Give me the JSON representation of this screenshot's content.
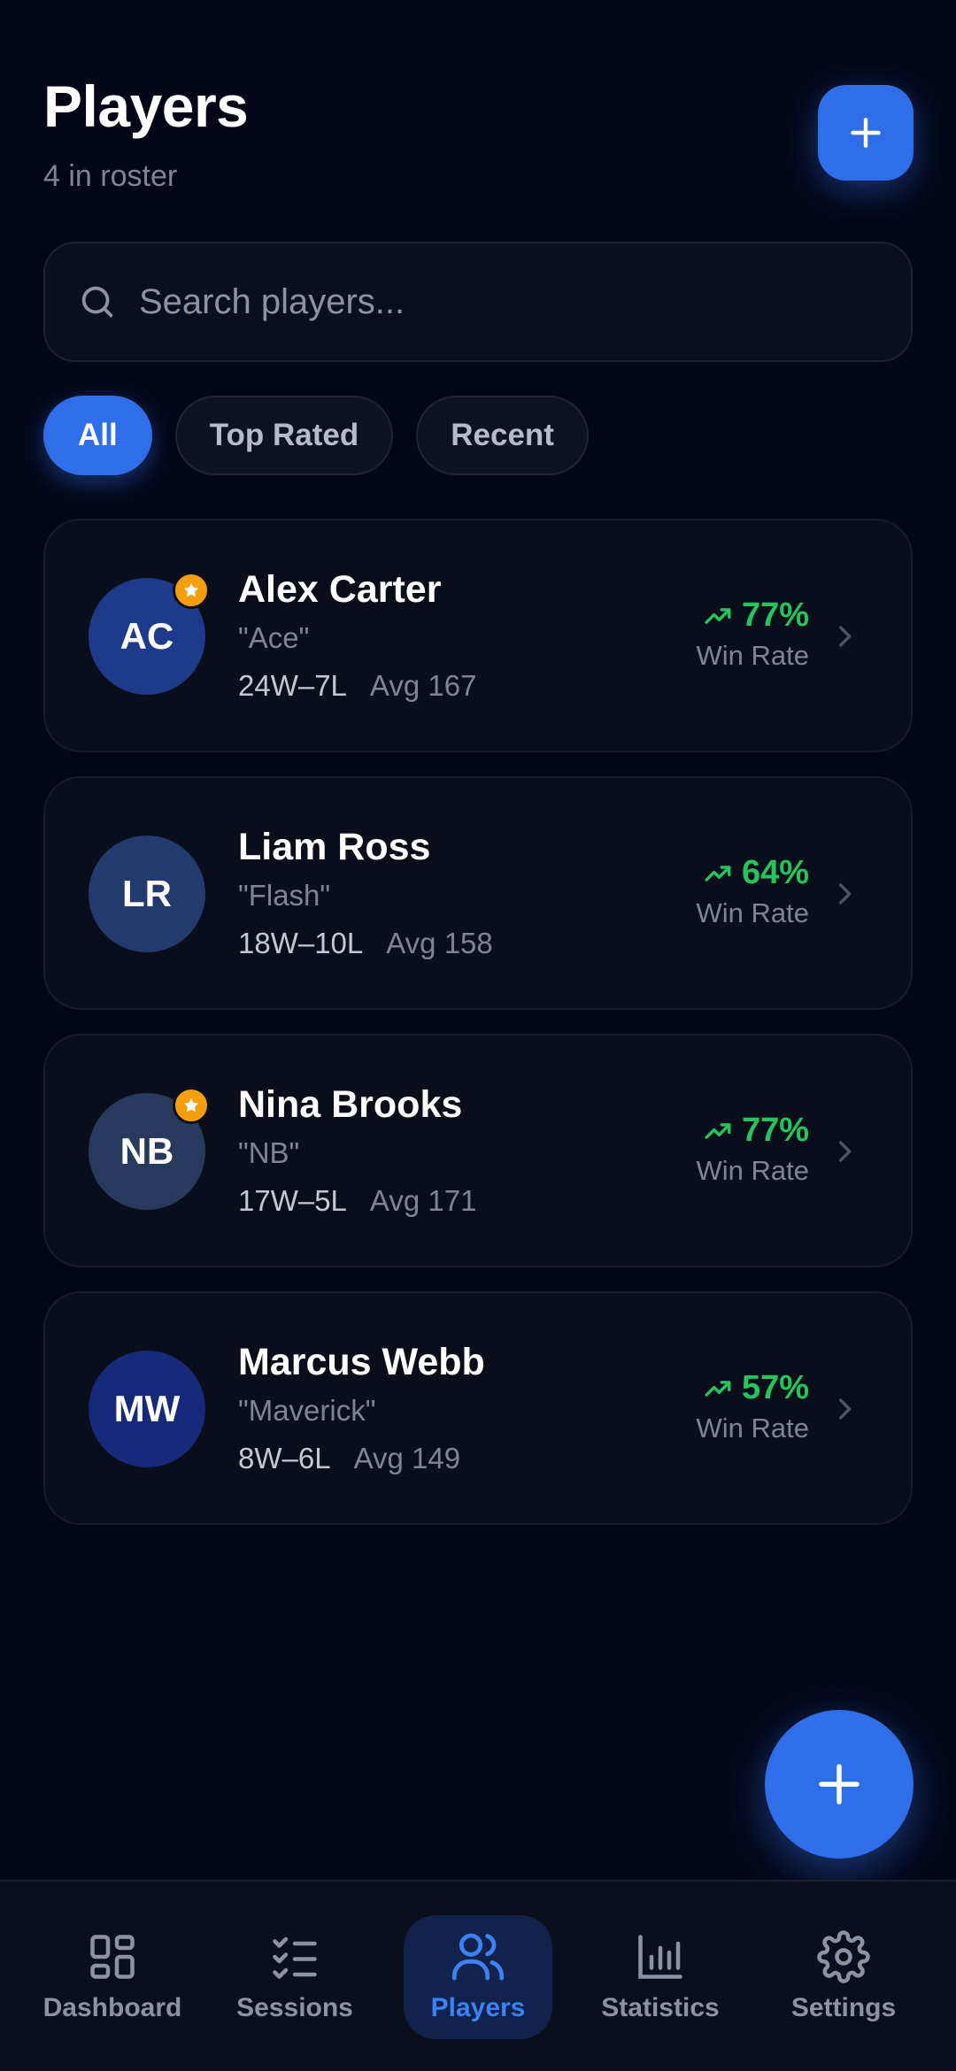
{
  "header": {
    "title": "Players",
    "subtitle": "4 in roster"
  },
  "search": {
    "placeholder": "Search players...",
    "value": ""
  },
  "filters": [
    {
      "label": "All",
      "active": true
    },
    {
      "label": "Top Rated",
      "active": false
    },
    {
      "label": "Recent",
      "active": false
    }
  ],
  "players": [
    {
      "initials": "AC",
      "name": "Alex Carter",
      "nickname": "\"Ace\"",
      "record": "24W–7L",
      "avg": "Avg 167",
      "win_rate": "77%",
      "win_rate_label": "Win Rate",
      "starred": true,
      "avatar_color": "#1e3a8a"
    },
    {
      "initials": "LR",
      "name": "Liam Ross",
      "nickname": "\"Flash\"",
      "record": "18W–10L",
      "avg": "Avg 158",
      "win_rate": "64%",
      "win_rate_label": "Win Rate",
      "starred": false,
      "avatar_color": "#223a6e"
    },
    {
      "initials": "NB",
      "name": "Nina Brooks",
      "nickname": "\"NB\"",
      "record": "17W–5L",
      "avg": "Avg 171",
      "win_rate": "77%",
      "win_rate_label": "Win Rate",
      "starred": true,
      "avatar_color": "#27395c"
    },
    {
      "initials": "MW",
      "name": "Marcus Webb",
      "nickname": "\"Maverick\"",
      "record": "8W–6L",
      "avg": "Avg 149",
      "win_rate": "57%",
      "win_rate_label": "Win Rate",
      "starred": false,
      "avatar_color": "#172a7a"
    }
  ],
  "nav": [
    {
      "label": "Dashboard",
      "icon": "grid-icon",
      "active": false
    },
    {
      "label": "Sessions",
      "icon": "checklist-icon",
      "active": false
    },
    {
      "label": "Players",
      "icon": "users-icon",
      "active": true
    },
    {
      "label": "Statistics",
      "icon": "bar-chart-icon",
      "active": false
    },
    {
      "label": "Settings",
      "icon": "gear-icon",
      "active": false
    }
  ],
  "colors": {
    "accent": "#2f6ee8",
    "positive": "#22c55e",
    "star": "#f59e0b",
    "background": "#030616"
  }
}
